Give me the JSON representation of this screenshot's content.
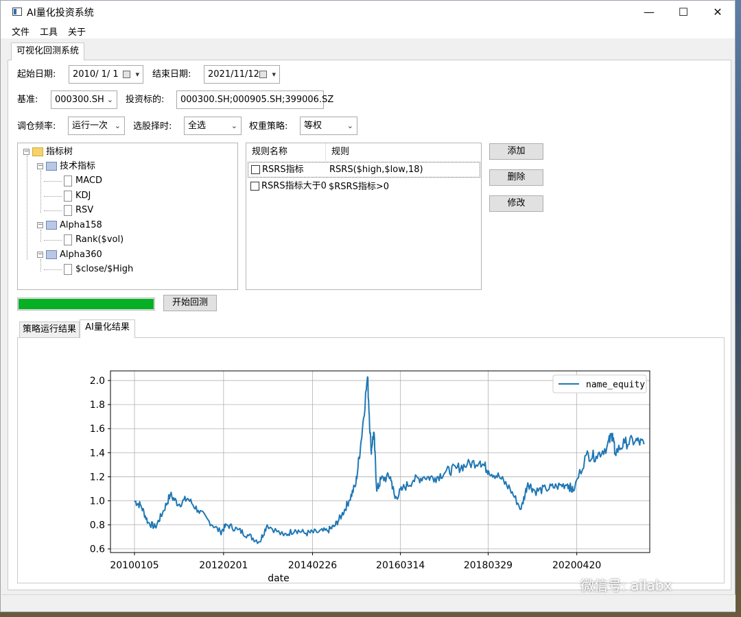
{
  "window": {
    "title": "AI量化投资系统",
    "minimize": "—",
    "maximize": "☐",
    "close": "✕"
  },
  "menu": [
    "文件",
    "工具",
    "关于"
  ],
  "main_tab": "可视化回测系统",
  "form": {
    "start_date_label": "起始日期:",
    "start_date": "2010/ 1/ 1",
    "end_date_label": "结束日期:",
    "end_date": "2021/11/12",
    "benchmark_label": "基准:",
    "benchmark": "000300.SH",
    "targets_label": "投资标的:",
    "targets": "000300.SH;000905.SH;399006.SZ",
    "rebalance_label": "调仓频率:",
    "rebalance": "运行一次",
    "timing_label": "选股择时:",
    "timing": "全选",
    "weight_label": "权重策略:",
    "weight": "等权"
  },
  "tree": {
    "root": "指标树",
    "groups": [
      {
        "label": "技术指标",
        "children": [
          "MACD",
          "KDJ",
          "RSV"
        ]
      },
      {
        "label": "Alpha158",
        "children": [
          "Rank($vol)"
        ]
      },
      {
        "label": "Alpha360",
        "children": [
          "$close/$High"
        ]
      }
    ]
  },
  "rules": {
    "headers": [
      "规则名称",
      "规则"
    ],
    "rows": [
      {
        "name": "RSRS指标",
        "rule": "RSRS($high,$low,18)",
        "checked": false
      },
      {
        "name": "RSRS指标大于0",
        "rule": "$RSRS指标>0",
        "checked": false
      }
    ]
  },
  "buttons": {
    "add": "添加",
    "delete": "删除",
    "edit": "修改",
    "start": "开始回测"
  },
  "progress": {
    "value": 1.0
  },
  "result_tabs": [
    "策略运行结果",
    "AI量化结果"
  ],
  "active_result_tab": 1,
  "watermark": "微信号: ailabx",
  "chart_data": {
    "type": "line",
    "xlabel": "date",
    "ylabel": "",
    "ylim": [
      0.57,
      2.08
    ],
    "yticks": [
      0.6,
      0.8,
      1.0,
      1.2,
      1.4,
      1.6,
      1.8,
      2.0
    ],
    "ytick_labels": [
      "0.6",
      "0.8",
      "1.0",
      "1.2",
      "1.4",
      "1.6",
      "1.8",
      "2.0"
    ],
    "xtick_labels": [
      "20100105",
      "20120201",
      "20140226",
      "20160314",
      "20180329",
      "20200420"
    ],
    "xlim": [
      "2009-06-15",
      "2021-12-31"
    ],
    "grid": true,
    "legend_position": "top-right",
    "colors": {
      "line": "#1f77b4"
    },
    "series": [
      {
        "name": "name_equity",
        "x": [
          "2010-01-05",
          "2010-03-01",
          "2010-05-01",
          "2010-07-01",
          "2010-09-01",
          "2010-11-05",
          "2011-01-15",
          "2011-04-01",
          "2011-07-01",
          "2011-10-01",
          "2012-01-05",
          "2012-03-01",
          "2012-06-01",
          "2012-09-01",
          "2012-12-04",
          "2013-02-05",
          "2013-06-25",
          "2013-10-01",
          "2014-01-01",
          "2014-04-01",
          "2014-07-01",
          "2014-09-01",
          "2014-11-01",
          "2015-01-01",
          "2015-03-01",
          "2015-04-15",
          "2015-06-08",
          "2015-07-08",
          "2015-08-01",
          "2015-08-26",
          "2015-10-01",
          "2015-12-20",
          "2016-01-28",
          "2016-04-01",
          "2016-07-01",
          "2016-10-01",
          "2017-01-01",
          "2017-04-01",
          "2017-07-01",
          "2017-10-01",
          "2018-01-20",
          "2018-04-01",
          "2018-07-01",
          "2018-10-01",
          "2019-01-03",
          "2019-03-01",
          "2019-05-01",
          "2019-08-01",
          "2019-11-01",
          "2020-02-01",
          "2020-03-20",
          "2020-07-10",
          "2020-10-01",
          "2021-01-01",
          "2021-02-18",
          "2021-03-10",
          "2021-06-01",
          "2021-09-01",
          "2021-11-12"
        ],
        "values": [
          1.0,
          0.96,
          0.82,
          0.78,
          0.9,
          1.05,
          0.97,
          1.02,
          0.92,
          0.83,
          0.74,
          0.8,
          0.76,
          0.71,
          0.66,
          0.8,
          0.71,
          0.76,
          0.73,
          0.74,
          0.75,
          0.79,
          0.88,
          1.0,
          1.14,
          1.5,
          2.03,
          1.42,
          1.57,
          1.08,
          1.18,
          1.2,
          1.02,
          1.1,
          1.17,
          1.2,
          1.19,
          1.24,
          1.27,
          1.3,
          1.33,
          1.25,
          1.2,
          1.1,
          0.93,
          1.15,
          1.08,
          1.1,
          1.12,
          1.14,
          1.08,
          1.38,
          1.37,
          1.45,
          1.56,
          1.4,
          1.48,
          1.5,
          1.47
        ]
      }
    ]
  }
}
